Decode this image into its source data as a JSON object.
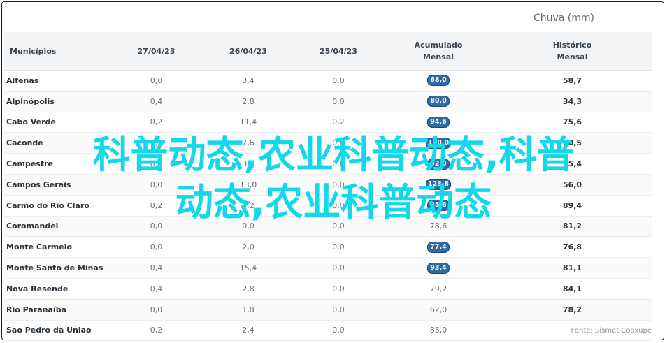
{
  "caption": "Chuva (mm)",
  "headers": {
    "municipios": "Municípios",
    "d1": "27/04/23",
    "d2": "26/04/23",
    "d3": "25/04/23",
    "acumulado_line1": "Acumulado",
    "acumulado_line2": "Mensal",
    "historico_line1": "Histórico",
    "historico_line2": "Mensal"
  },
  "rows": [
    {
      "municipio": "Alfenas",
      "d1": "0,0",
      "d2": "3,4",
      "d3": "0,0",
      "acumulado": "68,0",
      "badge": true,
      "historico": "58,7"
    },
    {
      "municipio": "Alpinópolis",
      "d1": "0,4",
      "d2": "2,8",
      "d3": "0,0",
      "acumulado": "80,0",
      "badge": true,
      "historico": "34,3"
    },
    {
      "municipio": "Cabo Verde",
      "d1": "0,2",
      "d2": "11,4",
      "d3": "0,2",
      "acumulado": "94,6",
      "badge": true,
      "historico": "75,6"
    },
    {
      "municipio": "Caconde",
      "d1": "0,2",
      "d2": "7,6",
      "d3": "0,0",
      "acumulado": "140,0",
      "badge": true,
      "historico": "70,5"
    },
    {
      "municipio": "Campestre",
      "d1": "0,2",
      "d2": "3,6",
      "d3": "0,0",
      "acumulado": "92,0",
      "badge": true,
      "historico": "75,4"
    },
    {
      "municipio": "Campos Gerais",
      "d1": "0,0",
      "d2": "13,0",
      "d3": "0,0",
      "acumulado": "123,8",
      "badge": true,
      "historico": "56,0"
    },
    {
      "municipio": "Carmo do Rio Claro",
      "d1": "0,2",
      "d2": "3,2",
      "d3": "0,0",
      "acumulado": "85,8",
      "badge": true,
      "historico": "89,4"
    },
    {
      "municipio": "Coromandel",
      "d1": "0,0",
      "d2": "0,0",
      "d3": "0,0",
      "acumulado": "78,6",
      "badge": false,
      "historico": "81,2"
    },
    {
      "municipio": "Monte Carmelo",
      "d1": "0,0",
      "d2": "2,0",
      "d3": "0,0",
      "acumulado": "77,4",
      "badge": true,
      "historico": "76,8"
    },
    {
      "municipio": "Monte Santo de Minas",
      "d1": "0,4",
      "d2": "15,4",
      "d3": "0,0",
      "acumulado": "93,4",
      "badge": true,
      "historico": "81,1"
    },
    {
      "municipio": "Nova Resende",
      "d1": "0,4",
      "d2": "2,8",
      "d3": "0,0",
      "acumulado": "79,2",
      "badge": false,
      "historico": "84,1"
    },
    {
      "municipio": "Rio Paranaíba",
      "d1": "0,0",
      "d2": "1,8",
      "d3": "0,0",
      "acumulado": "62,0",
      "badge": false,
      "historico": "78,2"
    },
    {
      "municipio": "Sao Pedro da Uniao",
      "d1": "0,2",
      "d2": "2,4",
      "d3": "0,0",
      "acumulado": "85,0",
      "badge": false,
      "historico": ""
    }
  ],
  "source": "Fonte: Sismet Cooxupé",
  "watermark_line1": "科普动态,农业科普动态,科普",
  "watermark_line2": "动态,农业科普动态",
  "colors": {
    "badge": "#2f6aa3",
    "watermark": "#14d8ea"
  }
}
